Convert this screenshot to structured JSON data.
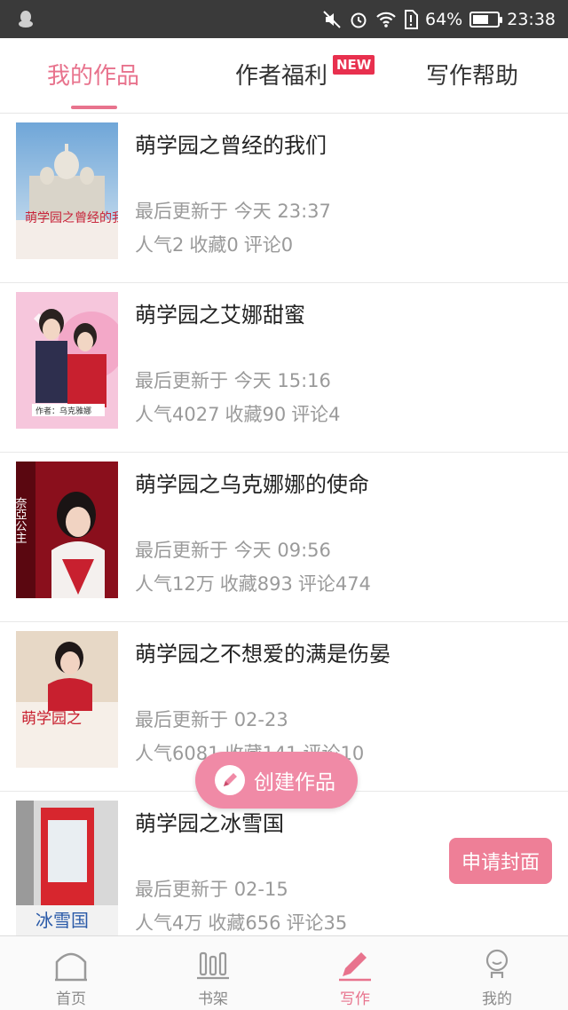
{
  "status_bar": {
    "battery_percent": "64%",
    "time": "23:38",
    "battery_level": 0.64
  },
  "tabs": [
    {
      "label": "我的作品",
      "active": true
    },
    {
      "label": "作者福利",
      "badge": "NEW"
    },
    {
      "label": "写作帮助"
    }
  ],
  "works": [
    {
      "title": "萌学园之曾经的我们",
      "updated_label": "最后更新于",
      "updated": "今天 23:37",
      "popularity": "人气2",
      "favorites": "收藏0",
      "comments": "评论0",
      "cover_text": "萌学园之曾经的我们"
    },
    {
      "title": "萌学园之艾娜甜蜜",
      "updated_label": "最后更新于",
      "updated": "今天 15:16",
      "popularity": "人气4027",
      "favorites": "收藏90",
      "comments": "评论4",
      "cover_text": "作者：乌克雅娜"
    },
    {
      "title": "萌学园之乌克娜娜的使命",
      "updated_label": "最后更新于",
      "updated": "今天 09:56",
      "popularity": "人气12万",
      "favorites": "收藏893",
      "comments": "评论474",
      "cover_text": "奈亞公主"
    },
    {
      "title": "萌学园之不想爱的满是伤晏",
      "updated_label": "最后更新于",
      "updated": "02-23",
      "popularity": "人气6081",
      "favorites": "收藏141",
      "comments": "评论10",
      "cover_text": "萌学园之"
    },
    {
      "title": "萌学园之冰雪国",
      "updated_label": "最后更新于",
      "updated": "02-15",
      "popularity": "人气4万",
      "favorites": "收藏656",
      "comments": "评论35",
      "cover_text": "冰雪国"
    }
  ],
  "create_button": {
    "label": "创建作品"
  },
  "apply_cover_button": {
    "label": "申请封面"
  },
  "bottom_nav": [
    {
      "label": "首页",
      "icon": "home-icon"
    },
    {
      "label": "书架",
      "icon": "bookshelf-icon"
    },
    {
      "label": "写作",
      "icon": "pencil-icon",
      "active": true
    },
    {
      "label": "我的",
      "icon": "profile-icon"
    }
  ],
  "colors": {
    "accent": "#e8738d",
    "badge": "#e8304e",
    "status_bar": "#3a3a3a",
    "floating_button": "#f08aa6"
  }
}
